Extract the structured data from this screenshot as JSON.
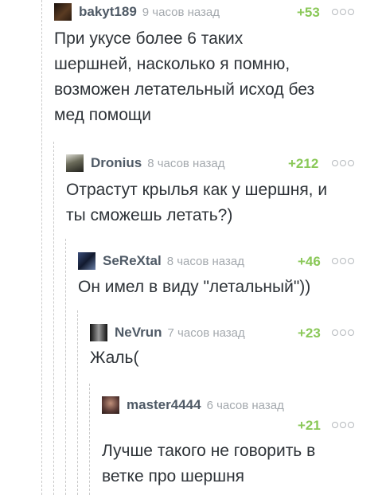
{
  "comments": [
    {
      "username": "bakyt189",
      "time": "9 часов назад",
      "rating": "+53",
      "text_lines": [
        "При укусе более 6 таких",
        "шершней, насколько я помню,",
        "возможен летательный исход без",
        "мед помощи"
      ],
      "avatar_color": "#3a2a1f"
    },
    {
      "username": "Dronius",
      "time": "8 часов назад",
      "rating": "+212",
      "text_lines": [
        "Отрастут крылья как у шершня, и",
        "ты сможешь летать?)"
      ],
      "avatar_color": "#4a4a40"
    },
    {
      "username": "SeReXtal",
      "time": "8 часов назад",
      "rating": "+46",
      "text_lines": [
        "Он имел в виду \"летальный\"))"
      ],
      "avatar_color": "#1f2a44"
    },
    {
      "username": "NeVrun",
      "time": "7 часов назад",
      "rating": "+23",
      "text_lines": [
        "Жаль("
      ],
      "avatar_color": "#2b2b2b"
    },
    {
      "username": "master4444",
      "time": "6 часов назад",
      "rating": "+21",
      "text_lines": [
        "Лучше такого не говорить в",
        "ветке про шершня"
      ],
      "avatar_color": "#5a3a35"
    }
  ],
  "colors": {
    "username": "#4f5a66",
    "time": "#a4a9ae",
    "rating": "#8ac858",
    "text": "#2e3338",
    "thread_line": "#c9c9c9"
  },
  "icons": {
    "more": "more-options-icon"
  }
}
